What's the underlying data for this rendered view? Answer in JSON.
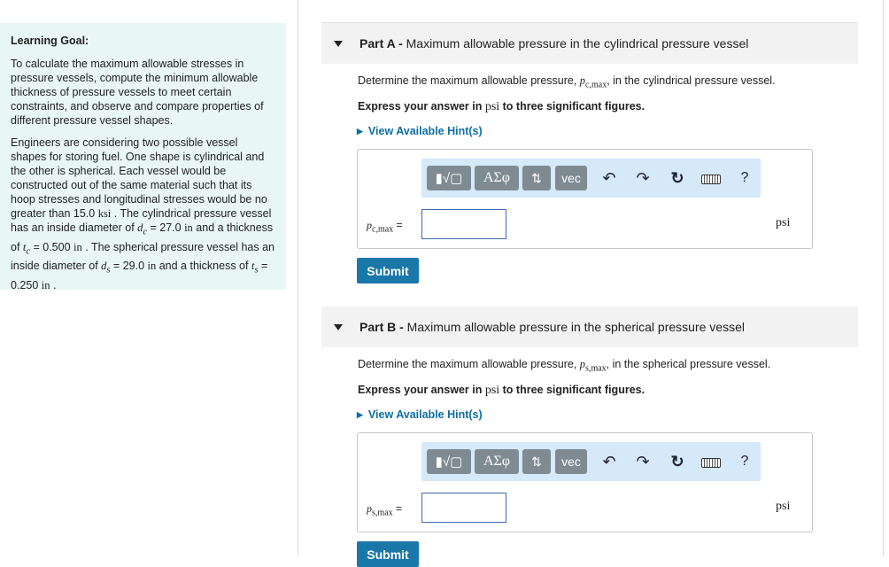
{
  "goal": {
    "title": "Learning Goal:",
    "intro": "To calculate the maximum allowable stresses in pressure vessels, compute the minimum allowable thickness of pressure vessels to meet certain constraints, and observe and compare properties of different pressure vessel shapes.",
    "para2_a": "Engineers are considering two possible vessel shapes for storing fuel. One shape is cylindrical and the other is spherical. Each vessel would be constructed out of the same material such that its hoop stresses and longitudinal stresses would be no greater than 15.0 ",
    "unit_ksi": "ksi",
    "para2_b": " . The cylindrical pressure vessel has an inside diameter of ",
    "dc": "d",
    "dc_sub": "c",
    "dc_val": " = 27.0 ",
    "unit_in": "in",
    "para2_c": " and a thickness of ",
    "tc": "t",
    "tc_sub": "c",
    "tc_val": " = 0.500 ",
    "para2_d": " . The spherical pressure vessel has an inside diameter of ",
    "ds": "d",
    "ds_sub": "s",
    "ds_val": " = 29.0 ",
    "para2_e": " and a thickness of ",
    "ts": "t",
    "ts_sub": "s",
    "ts_val": " = 0.250 ",
    "para2_f": " ."
  },
  "toolbar": {
    "templates": "▮√▢",
    "greek": "ΑΣφ",
    "arrows": "⇅",
    "vec": "vec",
    "undo": "↶",
    "redo": "↷",
    "reset": "↻",
    "help": "?"
  },
  "express_pre": "Express your answer in ",
  "express_unit": "psi",
  "express_post": " to three significant figures.",
  "hint": "View Available Hint(s)",
  "submit": "Submit",
  "unit": "psi",
  "partA": {
    "label": "Part A -",
    "title": " Maximum allowable pressure in the cylindrical pressure vessel",
    "question_pre": "Determine the maximum allowable pressure, ",
    "var": "p",
    "var_sub": "c,max",
    "question_post": ", in the cylindrical pressure vessel.",
    "answer_label": "p",
    "answer_sub": "c,max",
    "answer_eq": " ="
  },
  "partB": {
    "label": "Part B -",
    "title": " Maximum allowable pressure in the spherical pressure vessel",
    "question_pre": "Determine the maximum allowable pressure, ",
    "var": "p",
    "var_sub": "s,max",
    "question_post": ", in the spherical pressure vessel.",
    "answer_label": "p",
    "answer_sub": "s,max",
    "answer_eq": " ="
  }
}
